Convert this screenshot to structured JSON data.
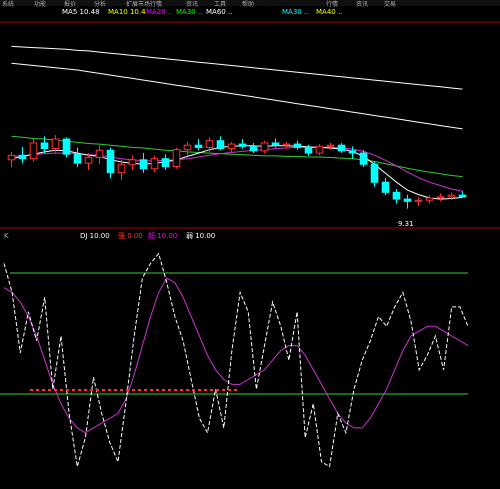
{
  "menu": [
    "系统",
    "功能",
    "报价",
    "分析",
    "扩展市场行情",
    "资讯",
    "工具",
    "帮助"
  ],
  "menu_right": [
    "行情",
    "资讯",
    "交易"
  ],
  "main_info": [
    {
      "text": "MA5 10.48",
      "color": "#ffffff"
    },
    {
      "text": "MA10 10.4",
      "color": "#ffff00"
    },
    {
      "text": "MA20 ..",
      "color": "#ff00ff"
    },
    {
      "text": "MA30 ..",
      "color": "#00ff00"
    },
    {
      "text": "MA60 ..",
      "color": "#ffffff"
    }
  ],
  "main_info_right": [
    {
      "text": "MA30 ..",
      "color": "#00ffff"
    },
    {
      "text": "MA40 ..",
      "color": "#ffff00"
    }
  ],
  "price_low_label": "9.31",
  "indicator_info": [
    {
      "text": "DJ 10.00",
      "color": "#ffffff"
    },
    {
      "text": "强 0.00",
      "color": "#ff3333"
    },
    {
      "text": "超 10.00",
      "color": "#ff00ff"
    },
    {
      "text": "弱 10.00",
      "color": "#ffffff"
    }
  ],
  "indicator_tag": "K",
  "colors": {
    "background": "#000000",
    "up": "#ff3030",
    "down": "#00ffff",
    "ma_white": "#ffffff",
    "ma_magenta": "#cc33cc",
    "ma_green": "#33cc33",
    "panel_border": "#aa0000"
  },
  "chart_data": {
    "type": "candlestick",
    "candles": [
      [
        10.18,
        10.32,
        10.05,
        10.26
      ],
      [
        10.26,
        10.41,
        10.12,
        10.2
      ],
      [
        10.2,
        10.55,
        10.15,
        10.48
      ],
      [
        10.48,
        10.6,
        10.3,
        10.38
      ],
      [
        10.38,
        10.62,
        10.3,
        10.55
      ],
      [
        10.55,
        10.58,
        10.22,
        10.28
      ],
      [
        10.28,
        10.4,
        10.05,
        10.12
      ],
      [
        10.12,
        10.3,
        10.0,
        10.22
      ],
      [
        10.22,
        10.44,
        10.1,
        10.35
      ],
      [
        10.35,
        10.4,
        9.85,
        9.95
      ],
      [
        9.95,
        10.18,
        9.82,
        10.1
      ],
      [
        10.1,
        10.26,
        10.0,
        10.18
      ],
      [
        10.18,
        10.3,
        9.95,
        10.02
      ],
      [
        10.02,
        10.25,
        9.96,
        10.2
      ],
      [
        10.2,
        10.28,
        10.0,
        10.06
      ],
      [
        10.06,
        10.4,
        10.02,
        10.36
      ],
      [
        10.36,
        10.5,
        10.25,
        10.44
      ],
      [
        10.44,
        10.55,
        10.35,
        10.4
      ],
      [
        10.4,
        10.58,
        10.32,
        10.52
      ],
      [
        10.52,
        10.6,
        10.35,
        10.38
      ],
      [
        10.38,
        10.5,
        10.3,
        10.46
      ],
      [
        10.46,
        10.55,
        10.38,
        10.42
      ],
      [
        10.42,
        10.48,
        10.3,
        10.34
      ],
      [
        10.34,
        10.52,
        10.3,
        10.48
      ],
      [
        10.48,
        10.56,
        10.4,
        10.44
      ],
      [
        10.44,
        10.5,
        10.38,
        10.46
      ],
      [
        10.46,
        10.52,
        10.36,
        10.4
      ],
      [
        10.4,
        10.45,
        10.25,
        10.3
      ],
      [
        10.3,
        10.46,
        10.26,
        10.42
      ],
      [
        10.42,
        10.48,
        10.36,
        10.44
      ],
      [
        10.44,
        10.48,
        10.3,
        10.34
      ],
      [
        10.34,
        10.42,
        10.2,
        10.3
      ],
      [
        10.3,
        10.35,
        10.05,
        10.1
      ],
      [
        10.1,
        10.15,
        9.7,
        9.78
      ],
      [
        9.78,
        9.86,
        9.55,
        9.6
      ],
      [
        9.6,
        9.66,
        9.4,
        9.48
      ],
      [
        9.48,
        9.56,
        9.31,
        9.44
      ],
      [
        9.44,
        9.52,
        9.36,
        9.46
      ],
      [
        9.46,
        9.55,
        9.4,
        9.5
      ],
      [
        9.5,
        9.58,
        9.44,
        9.52
      ],
      [
        9.52,
        9.6,
        9.46,
        9.55
      ],
      [
        9.55,
        9.62,
        9.5,
        9.52
      ]
    ],
    "ma_fast": [
      10.2,
      10.24,
      10.28,
      10.32,
      10.35,
      10.34,
      10.3,
      10.26,
      10.24,
      10.18,
      10.14,
      10.12,
      10.1,
      10.12,
      10.14,
      10.18,
      10.24,
      10.3,
      10.36,
      10.4,
      10.42,
      10.43,
      10.43,
      10.42,
      10.43,
      10.43,
      10.42,
      10.41,
      10.4,
      10.39,
      10.37,
      10.33,
      10.24,
      10.1,
      9.94,
      9.78,
      9.64,
      9.56,
      9.5,
      9.48,
      9.49,
      9.51
    ],
    "ma_mid": [
      10.24,
      10.25,
      10.27,
      10.29,
      10.3,
      10.3,
      10.29,
      10.27,
      10.26,
      10.23,
      10.2,
      10.18,
      10.16,
      10.16,
      10.17,
      10.18,
      10.2,
      10.23,
      10.26,
      10.29,
      10.31,
      10.33,
      10.35,
      10.36,
      10.38,
      10.39,
      10.4,
      10.4,
      10.4,
      10.4,
      10.39,
      10.37,
      10.33,
      10.26,
      10.17,
      10.07,
      9.96,
      9.86,
      9.78,
      9.72,
      9.66,
      9.62
    ],
    "ma_slow": [
      10.6,
      10.58,
      10.56,
      10.55,
      10.53,
      10.51,
      10.49,
      10.47,
      10.46,
      10.44,
      10.42,
      10.4,
      10.39,
      10.37,
      10.35,
      10.34,
      10.32,
      10.31,
      10.3,
      10.29,
      10.28,
      10.27,
      10.26,
      10.25,
      10.25,
      10.24,
      10.24,
      10.23,
      10.23,
      10.22,
      10.21,
      10.2,
      10.18,
      10.15,
      10.11,
      10.07,
      10.03,
      9.99,
      9.96,
      9.93,
      9.9,
      9.88
    ],
    "ma_long": [
      11.9,
      11.88,
      11.86,
      11.84,
      11.82,
      11.8,
      11.78,
      11.75,
      11.72,
      11.69,
      11.66,
      11.63,
      11.6,
      11.57,
      11.54,
      11.51,
      11.48,
      11.45,
      11.42,
      11.39,
      11.36,
      11.33,
      11.3,
      11.27,
      11.24,
      11.21,
      11.18,
      11.15,
      11.12,
      11.09,
      11.06,
      11.03,
      11.0,
      10.97,
      10.94,
      10.91,
      10.88,
      10.85,
      10.82,
      10.79,
      10.76,
      10.73
    ],
    "ma_long2": [
      12.2,
      12.19,
      12.18,
      12.17,
      12.16,
      12.15,
      12.13,
      12.12,
      12.1,
      12.08,
      12.06,
      12.04,
      12.02,
      12.0,
      11.98,
      11.96,
      11.94,
      11.92,
      11.9,
      11.88,
      11.86,
      11.84,
      11.82,
      11.8,
      11.78,
      11.76,
      11.74,
      11.72,
      11.7,
      11.68,
      11.66,
      11.64,
      11.62,
      11.6,
      11.58,
      11.56,
      11.54,
      11.52,
      11.5,
      11.48,
      11.46,
      11.44
    ],
    "price_range": [
      9.0,
      12.6
    ],
    "indicator_white": [
      92,
      80,
      55,
      72,
      60,
      78,
      40,
      62,
      30,
      8,
      20,
      45,
      30,
      18,
      10,
      35,
      62,
      86,
      92,
      96,
      84,
      70,
      60,
      44,
      28,
      22,
      40,
      24,
      56,
      80,
      72,
      40,
      58,
      76,
      66,
      52,
      72,
      20,
      34,
      10,
      8,
      30,
      22,
      40,
      52,
      60,
      70,
      66,
      74,
      80,
      68,
      48,
      54,
      62,
      48,
      74,
      74,
      66
    ],
    "indicator_magenta": [
      82,
      80,
      76,
      70,
      62,
      52,
      42,
      34,
      28,
      24,
      22,
      24,
      26,
      28,
      30,
      36,
      46,
      58,
      70,
      80,
      86,
      84,
      78,
      70,
      62,
      54,
      48,
      44,
      42,
      42,
      44,
      46,
      48,
      52,
      56,
      58,
      58,
      54,
      48,
      42,
      36,
      30,
      26,
      24,
      24,
      28,
      34,
      40,
      48,
      56,
      62,
      64,
      66,
      66,
      64,
      62,
      60,
      58
    ],
    "indicator_range": [
      0,
      100
    ],
    "indicator_upper_line": 88,
    "indicator_lower_line": 38
  }
}
